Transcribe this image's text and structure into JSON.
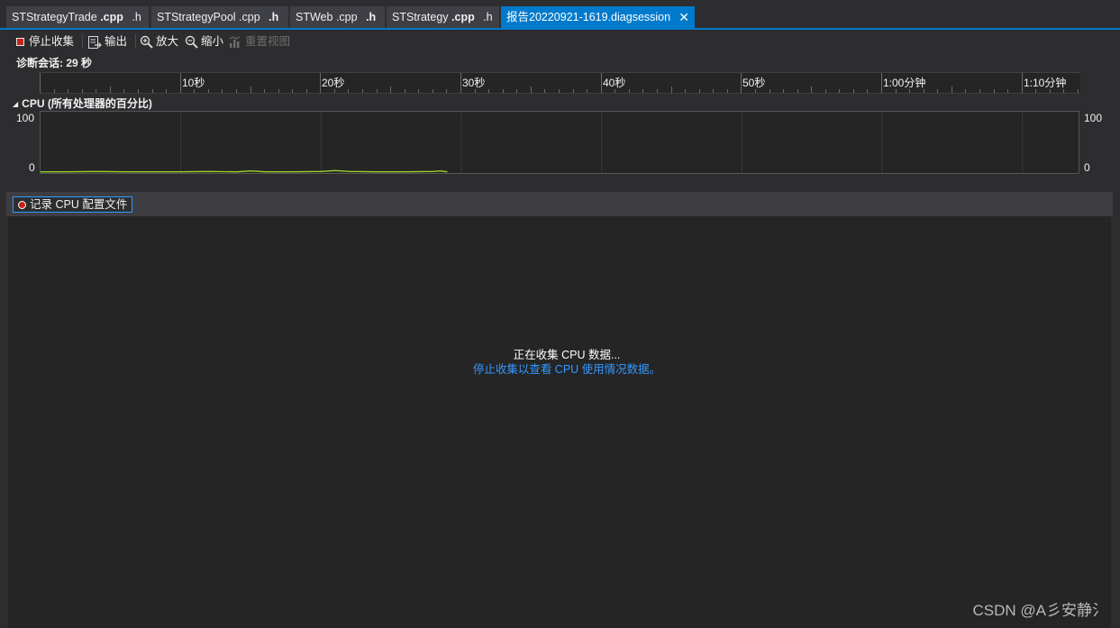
{
  "tabs": [
    {
      "name": "STStrategyTrade",
      "ext1": ".cpp",
      "ext2": ".h",
      "bold": 1,
      "active": false
    },
    {
      "name": "STStrategyPool",
      "ext1": ".cpp",
      "ext2": ".h",
      "bold": 2,
      "active": false
    },
    {
      "name": "STWeb",
      "ext1": ".cpp",
      "ext2": ".h",
      "bold": 2,
      "active": false
    },
    {
      "name": "STStrategy",
      "ext1": ".cpp",
      "ext2": ".h",
      "bold": 1,
      "active": false
    },
    {
      "name": "报告20220921-1619.diagsession",
      "active": true
    }
  ],
  "toolbar": {
    "stop_collect": "停止收集",
    "export": "输出",
    "zoom_in": "放大",
    "zoom_out": "缩小",
    "reset_view": "重置视图"
  },
  "session": {
    "label": "诊断会话: 29 秒"
  },
  "ruler": {
    "labels": [
      "10秒",
      "20秒",
      "30秒",
      "40秒",
      "50秒",
      "1:00分钟",
      "1:10分钟"
    ]
  },
  "cpu_panel": {
    "title": "CPU (所有处理器的百分比)",
    "y_max_label": "100",
    "y_min_label": "0"
  },
  "record_button": "记录 CPU 配置文件",
  "messages": {
    "collecting": "正在收集 CPU 数据...",
    "stop_hint": "停止收集以查看 CPU 使用情况数据。"
  },
  "chart_data": {
    "type": "line",
    "title": "CPU (所有处理器的百分比)",
    "ylim": [
      0,
      100
    ],
    "x_unit": "seconds",
    "xlim": [
      0,
      74
    ],
    "series": [
      {
        "color": "#9bd32a",
        "x": [
          0,
          2,
          4,
          6,
          8,
          10,
          12,
          14,
          15,
          16,
          18,
          20,
          21,
          22,
          24,
          26,
          28,
          28.5,
          29
        ],
        "values": [
          0.5,
          0.5,
          1,
          0.5,
          0.5,
          0.5,
          1,
          0.5,
          2,
          0.5,
          0.5,
          1,
          2.5,
          1,
          0.5,
          0.5,
          1,
          2,
          0.5
        ]
      }
    ]
  },
  "colors": {
    "accent": "#007acc",
    "link": "#3399ff",
    "cpu_line": "#9bd32a",
    "stop_red": "#c7221b"
  },
  "watermark": "CSDN @A彡安静氵"
}
